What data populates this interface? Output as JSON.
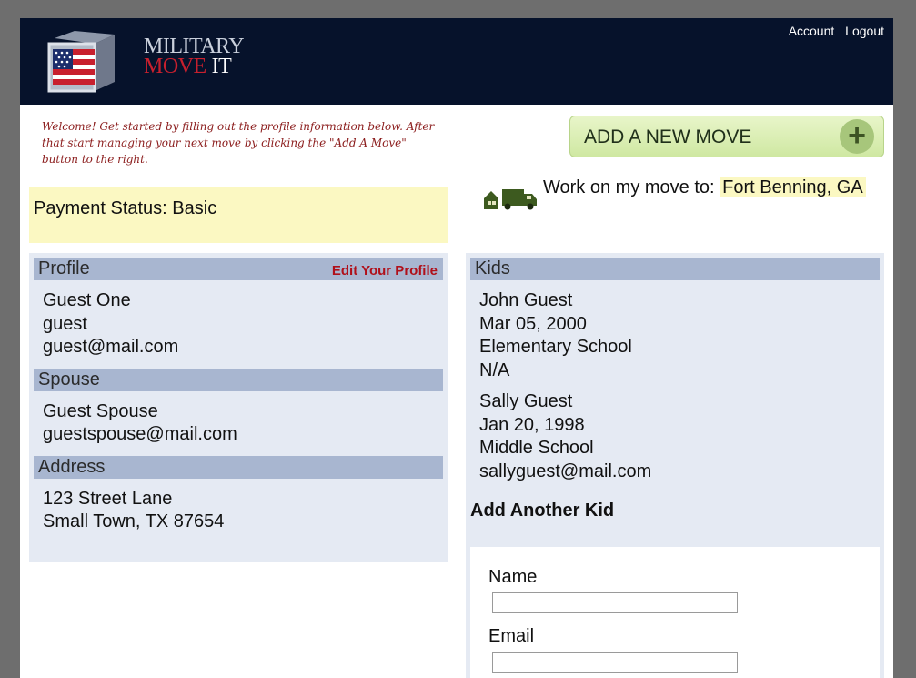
{
  "header": {
    "logo": {
      "line1": "MILITARY",
      "line2": "MOVE",
      "line2b": "IT"
    },
    "links": {
      "account": "Account",
      "logout": "Logout"
    }
  },
  "welcome_text": "Welcome! Get started by filling out the profile information below. After that start managing your next move by clicking the \"Add A Move\" button to the right.",
  "add_move": {
    "label": "ADD A NEW MOVE",
    "icon": "plus-icon"
  },
  "payment": {
    "text": "Payment Status: Basic"
  },
  "work_on": {
    "label": "Work on my move to:",
    "destination": "Fort Benning, GA",
    "icon": "truck-icon"
  },
  "profile": {
    "title": "Profile",
    "edit_link": "Edit Your Profile",
    "name": "Guest One",
    "username": "guest",
    "email": "guest@mail.com"
  },
  "spouse": {
    "title": "Spouse",
    "name": "Guest Spouse",
    "email": "guestspouse@mail.com"
  },
  "address": {
    "title": "Address",
    "line1": "123 Street Lane",
    "line2": "Small Town, TX 87654"
  },
  "kids": {
    "title": "Kids",
    "items": [
      {
        "name": "John Guest",
        "dob": "Mar 05, 2000",
        "school": "Elementary School",
        "contact": "N/A"
      },
      {
        "name": "Sally Guest",
        "dob": "Jan 20, 1998",
        "school": "Middle School",
        "contact": "sallyguest@mail.com"
      }
    ],
    "add_title": "Add Another Kid",
    "form": {
      "name_label": "Name",
      "name_value": "",
      "email_label": "Email",
      "email_value": ""
    }
  },
  "colors": {
    "header_bg": "#06122b",
    "accent_red": "#b0101a",
    "section_head": "#a8b6d0",
    "panel_bg": "#e5eaf3",
    "highlight": "#fbf8c2",
    "button_green": "#cfe8a2"
  }
}
